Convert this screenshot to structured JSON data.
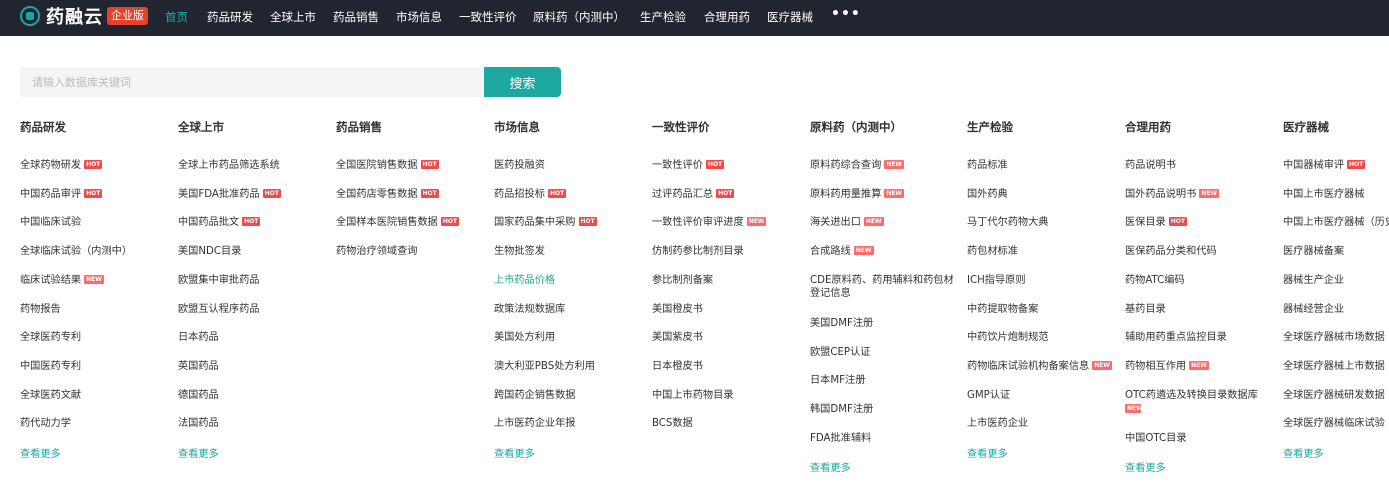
{
  "topbar": {
    "logo_text": "药融云",
    "logo_badge": "企业版",
    "nav": [
      "首页",
      "药品研发",
      "全球上市",
      "药品销售",
      "市场信息",
      "一致性评价",
      "原料药（内测中）",
      "生产检验",
      "合理用药",
      "医疗器械"
    ],
    "more_glyph": "•••",
    "colors": {
      "background": "#21252f",
      "active": "#18b3a6"
    }
  },
  "search": {
    "placeholder": "请输入数据库关键词",
    "button_label": "搜索",
    "accent": "#1ca8a0"
  },
  "columns": [
    {
      "title": "药品研发",
      "items": [
        {
          "label": "全球药物研发",
          "badge": "HOT"
        },
        {
          "label": "中国药品审评",
          "badge": "HOT"
        },
        {
          "label": "中国临床试验"
        },
        {
          "label": "全球临床试验（内测中）"
        },
        {
          "label": "临床试验结果",
          "badge": "NEW"
        },
        {
          "label": "药物报告"
        },
        {
          "label": "全球医药专利"
        },
        {
          "label": "中国医药专利"
        },
        {
          "label": "全球医药文献"
        },
        {
          "label": "药代动力学"
        }
      ],
      "more": "查看更多"
    },
    {
      "title": "全球上市",
      "items": [
        {
          "label": "全球上市药品筛选系统"
        },
        {
          "label": "美国FDA批准药品",
          "badge": "HOT"
        },
        {
          "label": "中国药品批文",
          "badge": "HOT"
        },
        {
          "label": "美国NDC目录"
        },
        {
          "label": "欧盟集中审批药品"
        },
        {
          "label": "欧盟互认程序药品"
        },
        {
          "label": "日本药品"
        },
        {
          "label": "英国药品"
        },
        {
          "label": "德国药品"
        },
        {
          "label": "法国药品"
        }
      ],
      "more": "查看更多"
    },
    {
      "title": "药品销售",
      "items": [
        {
          "label": "全国医院销售数据",
          "badge": "HOT"
        },
        {
          "label": "全国药店零售数据",
          "badge": "HOT"
        },
        {
          "label": "全国样本医院销售数据",
          "badge": "HOT"
        },
        {
          "label": "药物治疗领域查询"
        }
      ]
    },
    {
      "title": "市场信息",
      "items": [
        {
          "label": "医药投融资"
        },
        {
          "label": "药品招投标",
          "badge": "HOT"
        },
        {
          "label": "国家药品集中采购",
          "badge": "HOT"
        },
        {
          "label": "生物批签发"
        },
        {
          "label": "上市药品价格",
          "link": true
        },
        {
          "label": "政策法规数据库"
        },
        {
          "label": "美国处方利用"
        },
        {
          "label": "澳大利亚PBS处方利用"
        },
        {
          "label": "跨国药企销售数据"
        },
        {
          "label": "上市医药企业年报"
        }
      ],
      "more": "查看更多"
    },
    {
      "title": "一致性评价",
      "items": [
        {
          "label": "一致性评价",
          "badge": "HOT"
        },
        {
          "label": "过评药品汇总",
          "badge": "HOT"
        },
        {
          "label": "一致性评价审评进度",
          "badge": "NEW"
        },
        {
          "label": "仿制药参比制剂目录"
        },
        {
          "label": "参比制剂备案"
        },
        {
          "label": "美国橙皮书"
        },
        {
          "label": "美国紫皮书"
        },
        {
          "label": "日本橙皮书"
        },
        {
          "label": "中国上市药物目录"
        },
        {
          "label": "BCS数据"
        }
      ]
    },
    {
      "title": "原料药（内测中）",
      "items": [
        {
          "label": "原料药综合查询",
          "badge": "NEW"
        },
        {
          "label": "原料药用量推算",
          "badge": "NEW"
        },
        {
          "label": "海关进出口",
          "badge": "NEW"
        },
        {
          "label": "合成路线",
          "badge": "NEW"
        },
        {
          "label": "CDE原料药、药用辅料和药包材登记信息"
        },
        {
          "label": "美国DMF注册"
        },
        {
          "label": "欧盟CEP认证"
        },
        {
          "label": "日本MF注册"
        },
        {
          "label": "韩国DMF注册"
        },
        {
          "label": "FDA批准辅料"
        }
      ],
      "more": "查看更多"
    },
    {
      "title": "生产检验",
      "items": [
        {
          "label": "药品标准"
        },
        {
          "label": "国外药典"
        },
        {
          "label": "马丁代尔药物大典"
        },
        {
          "label": "药包材标准"
        },
        {
          "label": "ICH指导原则"
        },
        {
          "label": "中药提取物备案"
        },
        {
          "label": "中药饮片炮制规范"
        },
        {
          "label": "药物临床试验机构备案信息",
          "badge": "NEW"
        },
        {
          "label": "GMP认证"
        },
        {
          "label": "上市医药企业"
        }
      ],
      "more": "查看更多"
    },
    {
      "title": "合理用药",
      "items": [
        {
          "label": "药品说明书"
        },
        {
          "label": "国外药品说明书",
          "badge": "NEW"
        },
        {
          "label": "医保目录",
          "badge": "HOT"
        },
        {
          "label": "医保药品分类和代码"
        },
        {
          "label": "药物ATC编码"
        },
        {
          "label": "基药目录"
        },
        {
          "label": "辅助用药重点监控目录"
        },
        {
          "label": "药物相互作用",
          "badge": "NEW"
        },
        {
          "label": "OTC药遴选及转换目录数据库",
          "badge": "NEW"
        },
        {
          "label": "中国OTC目录"
        }
      ],
      "more": "查看更多"
    },
    {
      "title": "医疗器械",
      "items": [
        {
          "label": "中国器械审评",
          "badge": "HOT"
        },
        {
          "label": "中国上市医疗器械"
        },
        {
          "label": "中国上市医疗器械（历史"
        },
        {
          "label": "医疗器械备案"
        },
        {
          "label": "器械生产企业"
        },
        {
          "label": "器械经营企业"
        },
        {
          "label": "全球医疗器械市场数据"
        },
        {
          "label": "全球医疗器械上市数据"
        },
        {
          "label": "全球医疗器械研发数据"
        },
        {
          "label": "全球医疗器械临床试验"
        }
      ],
      "more": "查看更多"
    }
  ]
}
